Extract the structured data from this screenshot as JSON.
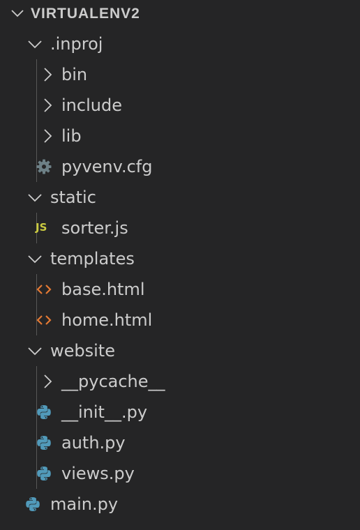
{
  "explorer": {
    "root": {
      "label": "VIRTUALENV2"
    },
    "inproj": {
      "label": ".inproj",
      "children": {
        "bin": "bin",
        "include": "include",
        "lib": "lib",
        "pyvenv": "pyvenv.cfg"
      }
    },
    "static": {
      "label": "static",
      "children": {
        "sorter": "sorter.js"
      },
      "js_badge": "JS"
    },
    "templates": {
      "label": "templates",
      "children": {
        "base": "base.html",
        "home": "home.html"
      }
    },
    "website": {
      "label": "website",
      "children": {
        "pycache": "__pycache__",
        "init": "__init__.py",
        "auth": "auth.py",
        "views": "views.py"
      }
    },
    "main": {
      "label": "main.py"
    }
  },
  "icons": {
    "chevron_down": "chevron-down-icon",
    "chevron_right": "chevron-right-icon",
    "settings_file": "gear-icon",
    "javascript_file": "javascript-icon",
    "html_file": "html-icon",
    "python_file": "python-icon"
  },
  "colors": {
    "background": "#252526",
    "text": "#cccccc",
    "gear": "#6d8086",
    "js": "#cbcb41",
    "html": "#e37933",
    "python_blue": "#519aba",
    "indent_guide": "#585858"
  }
}
